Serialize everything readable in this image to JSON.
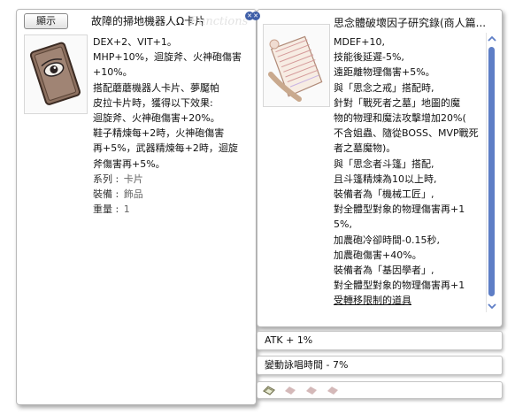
{
  "left_window": {
    "show_button": "顯示",
    "title": "故障的掃地機器人Ω卡片",
    "watermark": "Functions",
    "close_icon": "close-icon",
    "description": [
      "DEX+2、VIT+1。",
      "MHP+10%，迴旋斧、火神砲傷害",
      "+10%。",
      "搭配蘑蘑機器人卡片、夢魘帕",
      "皮拉卡片時，獲得以下效果:",
      "迴旋斧、火神砲傷害+20%。",
      "鞋子精煉每+2時，火神砲傷害",
      "再+5%，武器精煉每+2時，迴旋",
      "斧傷害再+5%。"
    ],
    "meta": [
      {
        "key": "系列",
        "value": "卡片"
      },
      {
        "key": "裝備",
        "value": "飾品"
      },
      {
        "key": "重量",
        "value": "1"
      }
    ]
  },
  "right_window": {
    "title": "思念體破壞因子研究錄(商人篇...",
    "close_icon": "close-icon",
    "lines": [
      "MDEF+10,",
      "技能後延遲-5%,",
      "遠距離物理傷害+5%。",
      "與「思念之戒」搭配時,",
      "針對「戰死者之墓」地圖的魔",
      "物的物理和魔法攻擊增加20%(",
      "不含姐蟲、隨從BOSS、MVP戰死",
      "者之墓魔物)。",
      "與「思念者斗篷」搭配,",
      "且斗篷精煉為10以上時,",
      "裝備者為「機械工匠」,",
      "對全體型對象的物理傷害再+1",
      "5%,",
      "加農砲冷卻時間-0.15秒,",
      "加農砲傷害+40%。",
      "裝備者為「基因學者」,",
      "對全體型對象的物理傷害再+1",
      "受轉移限制的道具"
    ]
  },
  "bars": {
    "atk": "ATK + 1%",
    "cast": "變動詠唱時間 - 7%"
  },
  "slots": {
    "count": 4,
    "filled": 1
  }
}
